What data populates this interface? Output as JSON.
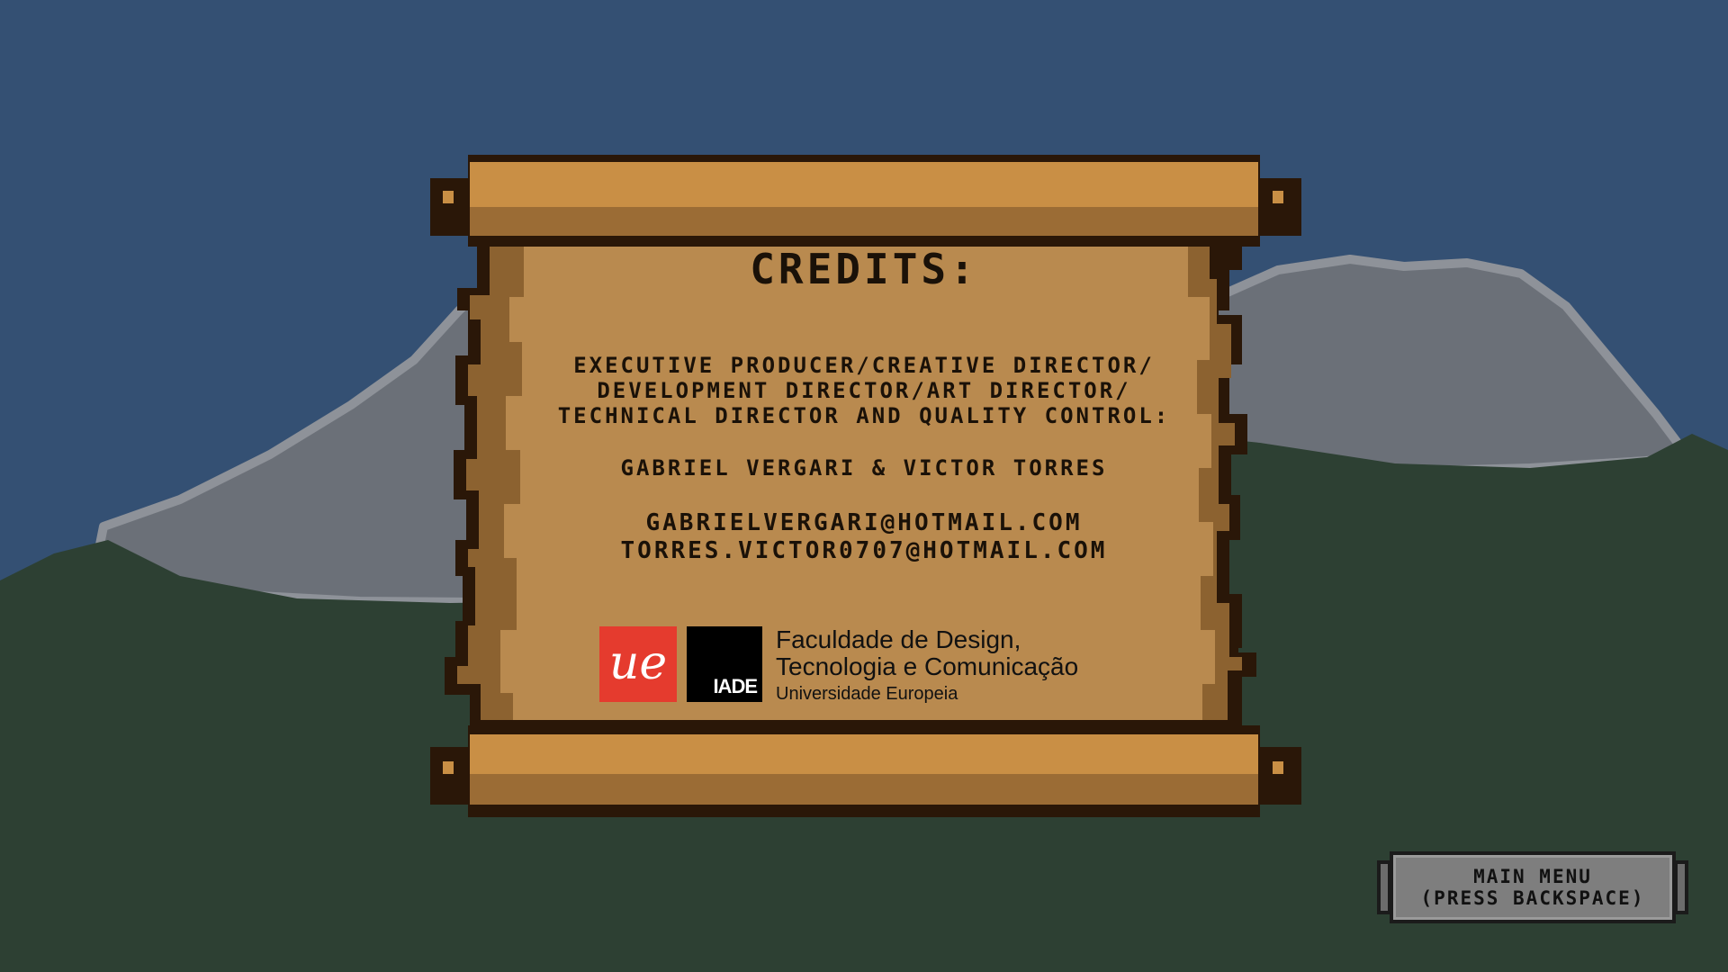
{
  "scroll": {
    "title": "CREDITS:",
    "roles": [
      "EXECUTIVE PRODUCER/CREATIVE DIRECTOR/",
      "DEVELOPMENT DIRECTOR/ART DIRECTOR/",
      "TECHNICAL DIRECTOR AND QUALITY CONTROL:"
    ],
    "names": "GABRIEL VERGARI & VICTOR TORRES",
    "emails": [
      "GABRIELVERGARI@HOTMAIL.COM",
      "TORRES.VICTOR0707@HOTMAIL.COM"
    ]
  },
  "logos": {
    "ue_mark": "ue",
    "iade_mark": "IADE",
    "line1": "Faculdade de Design,",
    "line2": "Tecnologia e Comunicação",
    "line3": "Universidade Europeia"
  },
  "menu_button": {
    "line1": "MAIN MENU",
    "line2": "(PRESS BACKSPACE)"
  },
  "colors": {
    "sky": "#345073",
    "ground": "#2d4033",
    "mountain": "#6b7078",
    "parchment": "#b98a4f",
    "wood": "#c98f45",
    "ue_red": "#e53b2e",
    "button": "#7e7e7e"
  }
}
